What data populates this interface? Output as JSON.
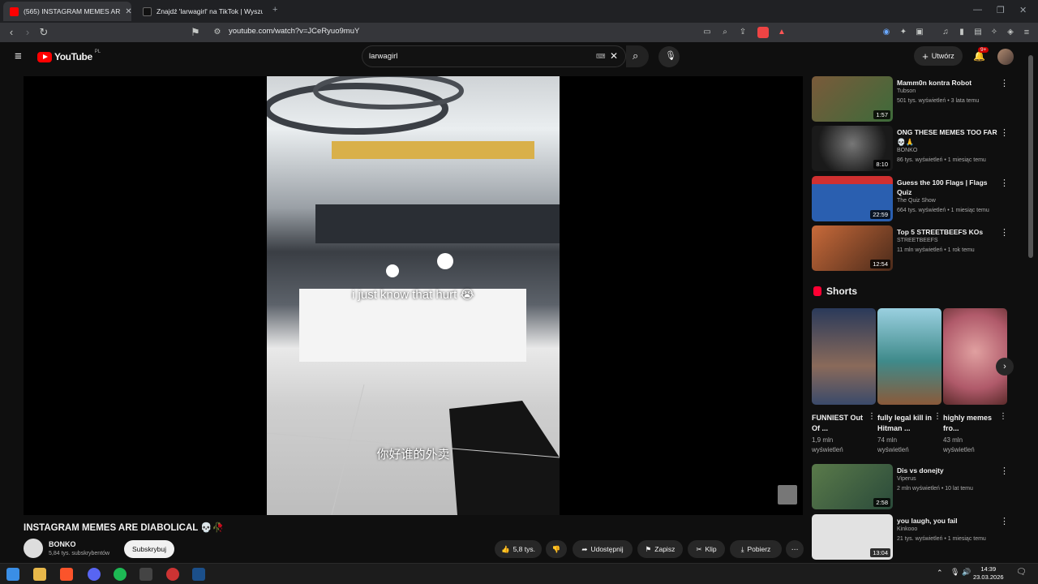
{
  "browser": {
    "tabs": [
      {
        "label": "(565) INSTAGRAM MEMES AR",
        "active": true
      },
      {
        "label": "Znajdź 'larwagirl' na TikTok | Wyszuk",
        "active": false
      }
    ],
    "new_tab": "+",
    "url": "youtube.com/watch?v=JCeRyuo9muY"
  },
  "youtube": {
    "logo": "YouTube",
    "region": "PL",
    "search_value": "larwagirl",
    "create_label": "Utwórz",
    "notif_count": "9+"
  },
  "video": {
    "subtitle_en": "i just know that hurt 😭",
    "subtitle_zh": "你好谁的外卖",
    "title": "INSTAGRAM MEMES ARE DIABOLICAL 💀🥀",
    "channel": "BONKO",
    "subscribers": "5,84 tys. subskrybentów",
    "subscribe_label": "Subskrybuj",
    "likes": "5,8 tys.",
    "share_label": "Udostępnij",
    "save_label": "Zapisz",
    "clip_label": "Klip",
    "download_label": "Pobierz"
  },
  "sidebar": {
    "recommendations": [
      {
        "title": "Mamm0n kontra Robot",
        "channel": "Tubson",
        "meta": "501 tys. wyświetleń • 3 lata temu",
        "duration": "1:57",
        "color": "#3d6b3a"
      },
      {
        "title": "ONG THESE MEMES TOO FAR 💀🙏",
        "channel": "BONKO",
        "meta": "86 tys. wyświetleń • 1 miesiąc temu",
        "duration": "8:10",
        "color": "#2b2b2b"
      },
      {
        "title": "Guess the 100 Flags | Flags Quiz",
        "channel": "The Quiz Show",
        "meta": "664 tys. wyświetleń • 1 miesiąc temu",
        "duration": "22:59",
        "color": "#3a5da8"
      },
      {
        "title": "Top 5 STREETBEEFS KOs",
        "channel": "STREETBEEFS",
        "meta": "11 mln wyświetleń • 1 rok temu",
        "duration": "12:54",
        "color": "#8a4a2a"
      }
    ],
    "shorts_label": "Shorts",
    "shorts": [
      {
        "title": "FUNNIEST Out Of ...",
        "views": "1,9 mln wyświetleń",
        "color": "#4a5a7a"
      },
      {
        "title": "fully legal kill in Hitman ...",
        "views": "74 mln wyświetleń",
        "color": "#3f8a8a"
      },
      {
        "title": "highly memes fro...",
        "views": "43 mln wyświetleń",
        "color": "#b05a6a"
      }
    ],
    "more": [
      {
        "title": "Dis vs donejty",
        "channel": "Viperus",
        "meta": "2 mln wyświetleń • 10 lat temu",
        "duration": "2:58",
        "color": "#3b5a3b"
      },
      {
        "title": "you laugh, you fail",
        "channel": "Kinkooo",
        "meta": "21 tys. wyświetleń • 1 miesiąc temu",
        "duration": "13:04",
        "color": "#d8d8d8"
      }
    ]
  },
  "taskbar": {
    "time": "14:39",
    "date": "23.03.2026"
  }
}
